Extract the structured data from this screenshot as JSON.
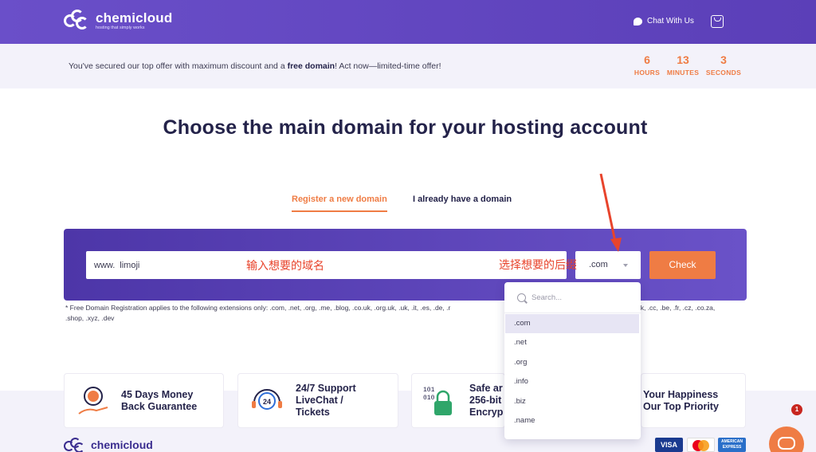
{
  "header": {
    "brand": "chemicloud",
    "tagline": "hosting that simply works",
    "chat_label": "Chat With Us"
  },
  "promo": {
    "text_pre": "You've secured our top offer with maximum discount and a ",
    "text_bold": "free domain",
    "text_post": "! Act now—limited-time offer!",
    "countdown": [
      {
        "value": "6",
        "unit": "HOURS"
      },
      {
        "value": "13",
        "unit": "MINUTES"
      },
      {
        "value": "3",
        "unit": "SECONDS"
      }
    ]
  },
  "main": {
    "title": "Choose the main domain for your hosting account",
    "tabs": [
      {
        "label": "Register a new domain",
        "active": true
      },
      {
        "label": "I already have a domain",
        "active": false
      }
    ],
    "search": {
      "prefix": "www.",
      "value": "limoji",
      "tld_selected": ".com",
      "check_label": "Check"
    },
    "annotations": {
      "domain": "输入想要的域名",
      "suffix": "选择想要的后缀"
    },
    "disclaimer_line1": "* Free Domain Registration applies to the following extensions only: .com, .net, .org, .me, .blog, .co.uk, .org.uk, .uk, .it, .es, .de, .r",
    "disclaimer_line1_tail": "dk, .cc, .be, .fr, .cz, .co.za,",
    "disclaimer_line2": ".shop, .xyz, .dev"
  },
  "dropdown": {
    "search_placeholder": "Search...",
    "options": [
      ".com",
      ".net",
      ".org",
      ".info",
      ".biz",
      ".name",
      "."
    ]
  },
  "features": [
    {
      "title_line1": "45 Days Money",
      "title_line2": "Back Guarantee"
    },
    {
      "title_line1": "24/7 Support",
      "title_line2": "LiveChat /",
      "title_line3": "Tickets"
    },
    {
      "title_line1": "Safe ar",
      "title_line2": "256-bit",
      "title_line3": "Encryp"
    },
    {
      "title_line1": "Your Happiness",
      "title_line2": "Our Top Priority"
    }
  ],
  "footer": {
    "brand": "chemicloud",
    "payments": [
      "VISA",
      "",
      "AMERICAN EXPRESS"
    ]
  },
  "chat_widget": {
    "badge": "1"
  },
  "colors": {
    "header": "#5b3fb8",
    "accent": "#ef7c44",
    "panel": "#4d36a8",
    "text": "#24234a",
    "annotation": "#e8442c"
  }
}
